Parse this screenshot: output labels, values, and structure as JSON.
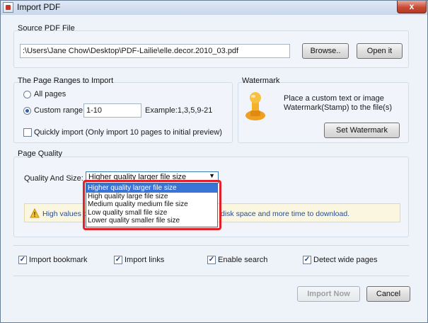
{
  "window": {
    "title": "Import PDF",
    "close_label": "x"
  },
  "source": {
    "group_label": "Source PDF File",
    "path": ":\\Users\\Jane Chow\\Desktop\\PDF-Lailie\\elle.decor.2010_03.pdf",
    "browse_label": "Browse..",
    "open_label": "Open it"
  },
  "ranges": {
    "group_label": "The Page Ranges to Import",
    "all_pages_label": "All pages",
    "custom_range_label": "Custom range:",
    "custom_range_value": "1-10",
    "example_label": "Example:1,3,5,9-21",
    "quick_import_label": "Quickly import (Only import 10 pages to  initial  preview)"
  },
  "watermark": {
    "group_label": "Watermark",
    "description_line1": "Place a custom text or image",
    "description_line2": "Watermark(Stamp) to the file(s)",
    "set_label": "Set Watermark",
    "icon": "watermark-stamp-icon"
  },
  "quality": {
    "group_label": "Page Quality",
    "label": "Quality And Size:",
    "selected": "Higher quality larger file size",
    "options": [
      "Higher quality larger file size",
      "High quality large file size",
      "Medium quality medium file size",
      "Low quality small file size",
      "Lower quality smaller file size"
    ],
    "warning_left": "High values p",
    "warning_right": "disk space and more time to download."
  },
  "options": {
    "import_bookmark": "Import bookmark",
    "import_links": "Import links",
    "enable_search": "Enable search",
    "detect_wide_pages": "Detect wide pages"
  },
  "footer": {
    "import_now_label": "Import Now",
    "cancel_label": "Cancel"
  },
  "colors": {
    "highlight": "#e2202a",
    "selection": "#3a74d6",
    "warning_text": "#2a4d8f"
  }
}
